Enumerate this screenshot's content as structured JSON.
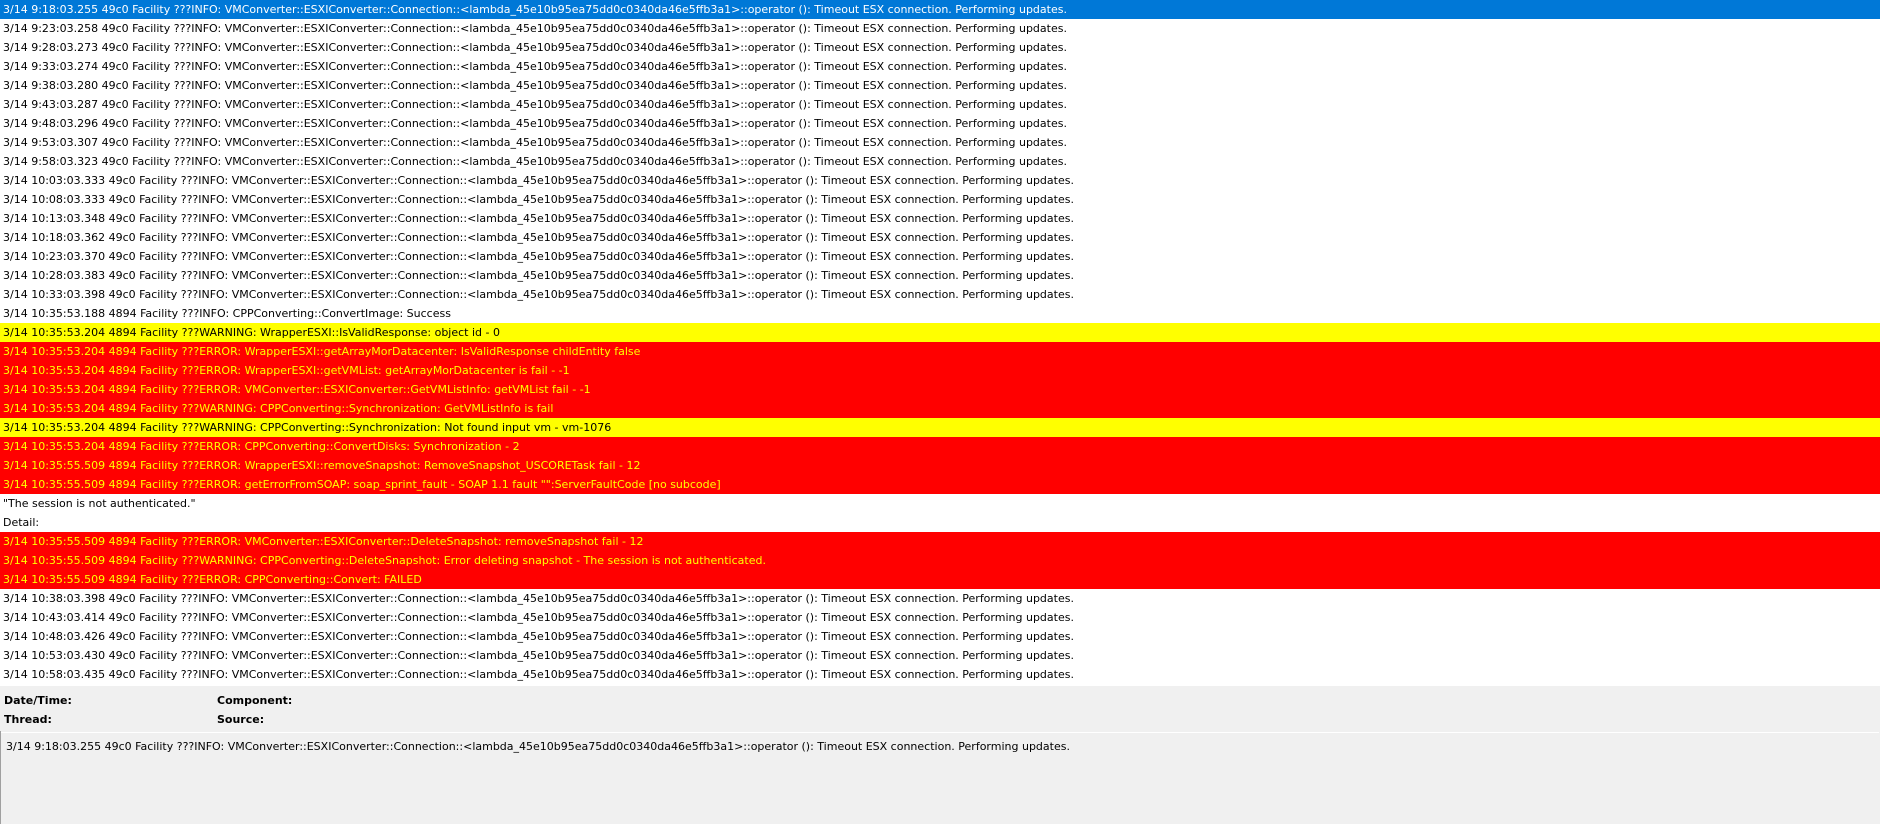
{
  "log": {
    "rows": [
      {
        "text": "3/14 9:18:03.255 49c0 Facility ???INFO: VMConverter::ESXIConverter::Connection::<lambda_45e10b95ea75dd0c0340da46e5ffb3a1>::operator (): Timeout ESX connection. Performing updates.",
        "level": "info",
        "selected": true
      },
      {
        "text": "3/14 9:23:03.258 49c0 Facility ???INFO: VMConverter::ESXIConverter::Connection::<lambda_45e10b95ea75dd0c0340da46e5ffb3a1>::operator (): Timeout ESX connection. Performing updates.",
        "level": "info"
      },
      {
        "text": "3/14 9:28:03.273 49c0 Facility ???INFO: VMConverter::ESXIConverter::Connection::<lambda_45e10b95ea75dd0c0340da46e5ffb3a1>::operator (): Timeout ESX connection. Performing updates.",
        "level": "info"
      },
      {
        "text": "3/14 9:33:03.274 49c0 Facility ???INFO: VMConverter::ESXIConverter::Connection::<lambda_45e10b95ea75dd0c0340da46e5ffb3a1>::operator (): Timeout ESX connection. Performing updates.",
        "level": "info"
      },
      {
        "text": "3/14 9:38:03.280 49c0 Facility ???INFO: VMConverter::ESXIConverter::Connection::<lambda_45e10b95ea75dd0c0340da46e5ffb3a1>::operator (): Timeout ESX connection. Performing updates.",
        "level": "info"
      },
      {
        "text": "3/14 9:43:03.287 49c0 Facility ???INFO: VMConverter::ESXIConverter::Connection::<lambda_45e10b95ea75dd0c0340da46e5ffb3a1>::operator (): Timeout ESX connection. Performing updates.",
        "level": "info"
      },
      {
        "text": "3/14 9:48:03.296 49c0 Facility ???INFO: VMConverter::ESXIConverter::Connection::<lambda_45e10b95ea75dd0c0340da46e5ffb3a1>::operator (): Timeout ESX connection. Performing updates.",
        "level": "info"
      },
      {
        "text": "3/14 9:53:03.307 49c0 Facility ???INFO: VMConverter::ESXIConverter::Connection::<lambda_45e10b95ea75dd0c0340da46e5ffb3a1>::operator (): Timeout ESX connection. Performing updates.",
        "level": "info"
      },
      {
        "text": "3/14 9:58:03.323 49c0 Facility ???INFO: VMConverter::ESXIConverter::Connection::<lambda_45e10b95ea75dd0c0340da46e5ffb3a1>::operator (): Timeout ESX connection. Performing updates.",
        "level": "info"
      },
      {
        "text": "3/14 10:03:03.333 49c0 Facility ???INFO: VMConverter::ESXIConverter::Connection::<lambda_45e10b95ea75dd0c0340da46e5ffb3a1>::operator (): Timeout ESX connection. Performing updates.",
        "level": "info"
      },
      {
        "text": "3/14 10:08:03.333 49c0 Facility ???INFO: VMConverter::ESXIConverter::Connection::<lambda_45e10b95ea75dd0c0340da46e5ffb3a1>::operator (): Timeout ESX connection. Performing updates.",
        "level": "info"
      },
      {
        "text": "3/14 10:13:03.348 49c0 Facility ???INFO: VMConverter::ESXIConverter::Connection::<lambda_45e10b95ea75dd0c0340da46e5ffb3a1>::operator (): Timeout ESX connection. Performing updates.",
        "level": "info"
      },
      {
        "text": "3/14 10:18:03.362 49c0 Facility ???INFO: VMConverter::ESXIConverter::Connection::<lambda_45e10b95ea75dd0c0340da46e5ffb3a1>::operator (): Timeout ESX connection. Performing updates.",
        "level": "info"
      },
      {
        "text": "3/14 10:23:03.370 49c0 Facility ???INFO: VMConverter::ESXIConverter::Connection::<lambda_45e10b95ea75dd0c0340da46e5ffb3a1>::operator (): Timeout ESX connection. Performing updates.",
        "level": "info"
      },
      {
        "text": "3/14 10:28:03.383 49c0 Facility ???INFO: VMConverter::ESXIConverter::Connection::<lambda_45e10b95ea75dd0c0340da46e5ffb3a1>::operator (): Timeout ESX connection. Performing updates.",
        "level": "info"
      },
      {
        "text": "3/14 10:33:03.398 49c0 Facility ???INFO: VMConverter::ESXIConverter::Connection::<lambda_45e10b95ea75dd0c0340da46e5ffb3a1>::operator (): Timeout ESX connection. Performing updates.",
        "level": "info"
      },
      {
        "text": "3/14 10:35:53.188 4894 Facility ???INFO: CPPConverting::ConvertImage: Success",
        "level": "info"
      },
      {
        "text": "3/14 10:35:53.204 4894 Facility ???WARNING: WrapperESXI::IsValidResponse: object id - 0",
        "level": "warning"
      },
      {
        "text": "3/14 10:35:53.204 4894 Facility ???ERROR: WrapperESXI::getArrayMorDatacenter: IsValidResponse childEntity false",
        "level": "error"
      },
      {
        "text": "3/14 10:35:53.204 4894 Facility ???ERROR: WrapperESXI::getVMList: getArrayMorDatacenter is fail - -1",
        "level": "error"
      },
      {
        "text": "3/14 10:35:53.204 4894 Facility ???ERROR: VMConverter::ESXIConverter::GetVMListInfo: getVMList fail - -1",
        "level": "error"
      },
      {
        "text": "3/14 10:35:53.204 4894 Facility ???WARNING: CPPConverting::Synchronization: GetVMListInfo is fail",
        "level": "error"
      },
      {
        "text": "3/14 10:35:53.204 4894 Facility ???WARNING: CPPConverting::Synchronization: Not found input vm - vm-1076",
        "level": "warning"
      },
      {
        "text": "3/14 10:35:53.204 4894 Facility ???ERROR: CPPConverting::ConvertDisks: Synchronization - 2",
        "level": "error"
      },
      {
        "text": "3/14 10:35:55.509 4894 Facility ???ERROR: WrapperESXI::removeSnapshot: RemoveSnapshot_USCORETask fail - 12",
        "level": "error"
      },
      {
        "text": "3/14 10:35:55.509 4894 Facility ???ERROR: getErrorFromSOAP: soap_sprint_fault - SOAP 1.1 fault \"\":ServerFaultCode [no subcode]",
        "level": "error"
      },
      {
        "text": "\"The session is not authenticated.\"",
        "level": "continuation"
      },
      {
        "text": "Detail:",
        "level": "continuation"
      },
      {
        "text": "3/14 10:35:55.509 4894 Facility ???ERROR: VMConverter::ESXIConverter::DeleteSnapshot: removeSnapshot fail - 12",
        "level": "error"
      },
      {
        "text": "3/14 10:35:55.509 4894 Facility ???WARNING: CPPConverting::DeleteSnapshot: Error deleting snapshot - The session is not authenticated.",
        "level": "error"
      },
      {
        "text": "3/14 10:35:55.509 4894 Facility ???ERROR: CPPConverting::Convert: FAILED",
        "level": "error"
      },
      {
        "text": "3/14 10:38:03.398 49c0 Facility ???INFO: VMConverter::ESXIConverter::Connection::<lambda_45e10b95ea75dd0c0340da46e5ffb3a1>::operator (): Timeout ESX connection. Performing updates.",
        "level": "info"
      },
      {
        "text": "3/14 10:43:03.414 49c0 Facility ???INFO: VMConverter::ESXIConverter::Connection::<lambda_45e10b95ea75dd0c0340da46e5ffb3a1>::operator (): Timeout ESX connection. Performing updates.",
        "level": "info"
      },
      {
        "text": "3/14 10:48:03.426 49c0 Facility ???INFO: VMConverter::ESXIConverter::Connection::<lambda_45e10b95ea75dd0c0340da46e5ffb3a1>::operator (): Timeout ESX connection. Performing updates.",
        "level": "info"
      },
      {
        "text": "3/14 10:53:03.430 49c0 Facility ???INFO: VMConverter::ESXIConverter::Connection::<lambda_45e10b95ea75dd0c0340da46e5ffb3a1>::operator (): Timeout ESX connection. Performing updates.",
        "level": "info"
      },
      {
        "text": "3/14 10:58:03.435 49c0 Facility ???INFO: VMConverter::ESXIConverter::Connection::<lambda_45e10b95ea75dd0c0340da46e5ffb3a1>::operator (): Timeout ESX connection. Performing updates.",
        "level": "info"
      }
    ]
  },
  "details": {
    "datetime_label": "Date/Time:",
    "component_label": "Component:",
    "thread_label": "Thread:",
    "source_label": "Source:",
    "message": "3/14 9:18:03.255 49c0 Facility ???INFO: VMConverter::ESXIConverter::Connection::<lambda_45e10b95ea75dd0c0340da46e5ffb3a1>::operator (): Timeout ESX connection. Performing updates."
  },
  "colors": {
    "selected": "#0078d7",
    "warning": "#ffff00",
    "error": "#ff0000",
    "error_text": "#ffff00",
    "panel": "#f0f0f0"
  }
}
